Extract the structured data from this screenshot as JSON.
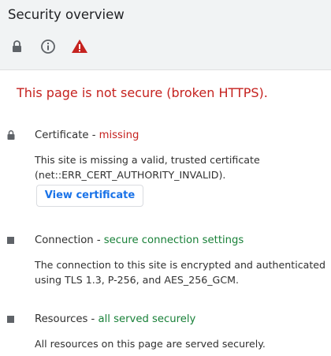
{
  "header": {
    "title": "Security overview"
  },
  "summary": {
    "message": "This page is not secure (broken HTTPS)."
  },
  "sections": {
    "certificate": {
      "title": "Certificate",
      "separator": " - ",
      "status": "missing",
      "description": "This site is missing a valid, trusted certificate (net::ERR_CERT_AUTHORITY_INVALID).",
      "button_label": "View certificate"
    },
    "connection": {
      "title": "Connection",
      "separator": " - ",
      "status": "secure connection settings",
      "description": "The connection to this site is encrypted and authenticated using TLS 1.3, P-256, and AES_256_GCM."
    },
    "resources": {
      "title": "Resources",
      "separator": " - ",
      "status": "all served securely",
      "description": "All resources on this page are served securely."
    }
  },
  "colors": {
    "error": "#c5221f",
    "success": "#188038",
    "link": "#1a73e8",
    "header_bg": "#f1f3f4"
  },
  "icons": {
    "tabs": [
      "lock-icon",
      "info-icon",
      "warning-icon"
    ],
    "certificate": "lock-icon",
    "connection": "square-icon",
    "resources": "square-icon"
  }
}
